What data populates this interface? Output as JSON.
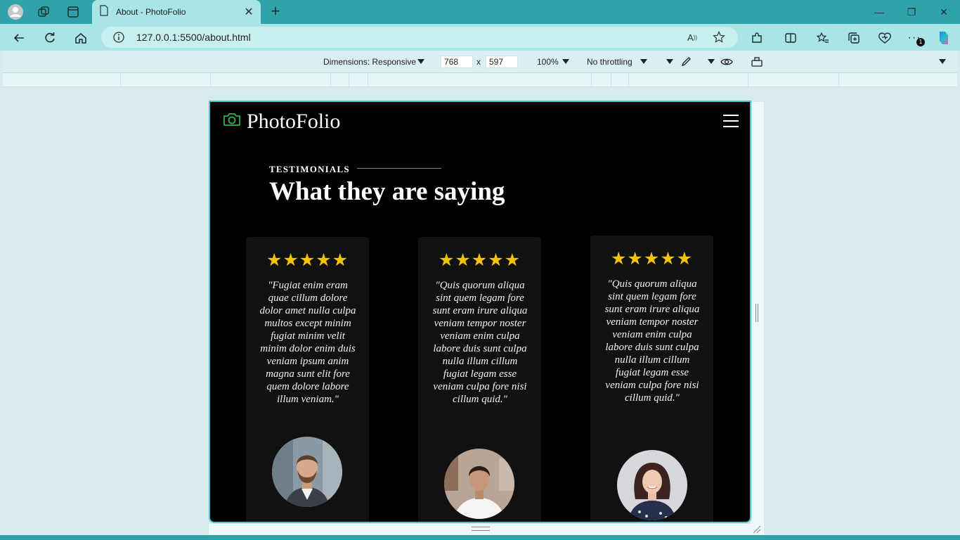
{
  "browser": {
    "tab_title": "About - PhotoFolio",
    "url": "127.0.0.1:5500/about.html",
    "read_aloud_label": "A",
    "notification_count": "1"
  },
  "devtools": {
    "dimensions_label": "Dimensions: Responsive",
    "width": "768",
    "height": "597",
    "separator": "x",
    "zoom": "100%",
    "throttling": "No throttling"
  },
  "site": {
    "logo_text": "PhotoFolio",
    "eyebrow": "TESTIMONIALS",
    "title": "What they are saying"
  },
  "testimonials": [
    {
      "stars": "★★★★★",
      "rating": 5,
      "quote": "\"Fugiat enim eram quae cillum dolore dolor amet nulla culpa multos except minim fugiat minim velit minim dolor enim duis veniam ipsum anim magna sunt elit fore quem dolore labore illum veniam.\"",
      "avatar": "man-with-beard-photo"
    },
    {
      "stars": "★★★★★",
      "rating": 5,
      "quote": "\"Quis quorum aliqua sint quem legam fore sunt eram irure aliqua veniam tempor noster veniam enim culpa labore duis sunt culpa nulla illum cillum fugiat legam esse veniam culpa fore nisi cillum quid.\"",
      "avatar": "woman-white-shirt-photo"
    },
    {
      "stars": "★★★★★",
      "rating": 5,
      "quote": "\"Quis quorum aliqua sint quem legam fore sunt eram irure aliqua veniam tempor noster veniam enim culpa labore duis sunt culpa nulla illum cillum fugiat legam esse veniam culpa fore nisi cillum quid.\"",
      "avatar": "woman-curly-hair-photo"
    }
  ],
  "colors": {
    "accent_green": "#2db34a",
    "star_gold": "#f5c400",
    "browser_teal": "#2fa3a9"
  }
}
